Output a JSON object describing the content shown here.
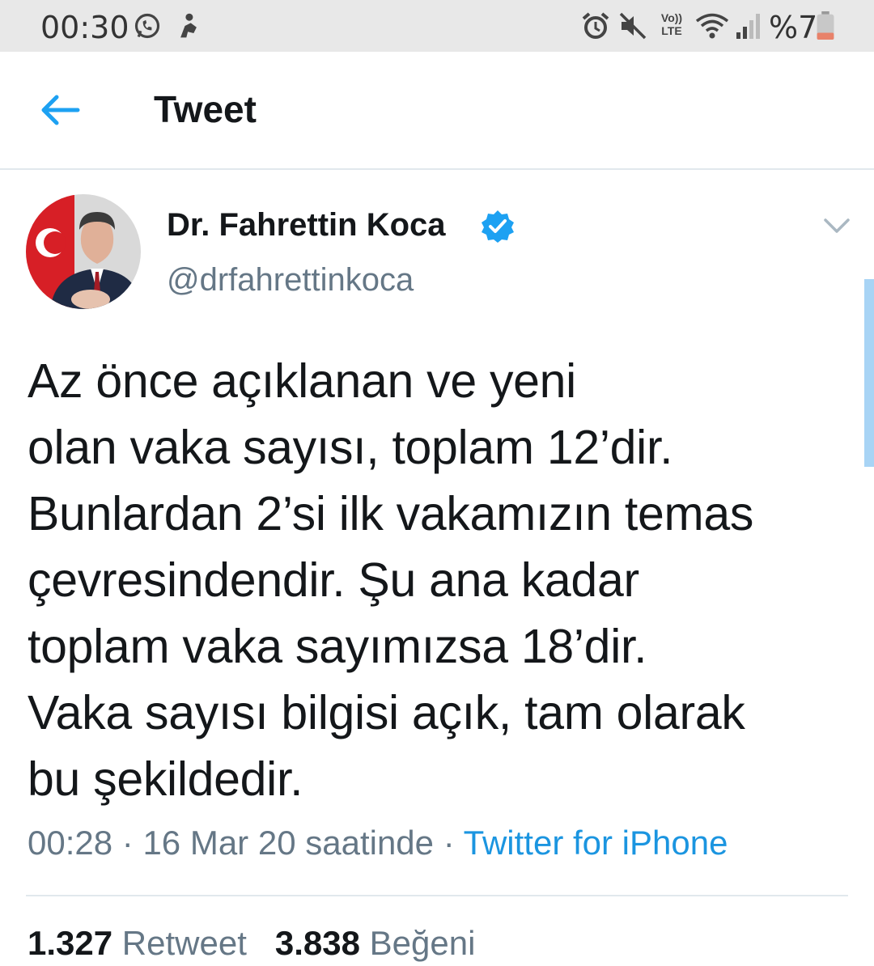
{
  "status_bar": {
    "time": "00:30",
    "battery_text": "%7",
    "signal_text": "Vo)) LTE"
  },
  "header": {
    "title": "Tweet",
    "back_icon": "arrow-left-icon"
  },
  "tweet": {
    "author_name": "Dr. Fahrettin Koca",
    "author_handle": "@drfahrettinkoca",
    "text_lines": [
      "Az önce açıklanan ve yeni",
      "olan vaka sayısı, toplam 12’dir.",
      "Bunlardan 2’si ilk vakamızın temas",
      "çevresindendir. Şu ana kadar",
      "toplam vaka sayımızsa 18’dir.",
      "Vaka sayısı bilgisi açık, tam olarak",
      "bu şekildedir."
    ],
    "time": "00:28",
    "date": "16 Mar 20 saatinde",
    "separator": "·",
    "source": "Twitter for iPhone",
    "retweet_count": "1.327",
    "retweet_label": "Retweet",
    "like_count": "3.838",
    "like_label": "Beğeni"
  },
  "colors": {
    "accent": "#1da1f2",
    "secondary_text": "#657786",
    "primary_text": "#14171a",
    "statusbar_bg": "#e8e8e8"
  }
}
